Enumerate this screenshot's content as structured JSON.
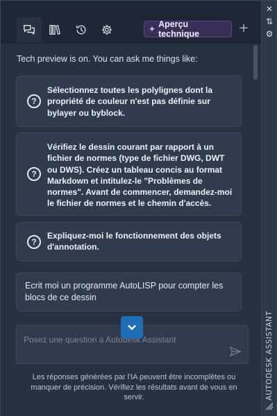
{
  "strip": {
    "close_glyph": "✕",
    "autohide_glyph": "⇅",
    "properties_glyph": "⚙",
    "title": "AUTODESK ASSISTANT"
  },
  "tabs": [
    {
      "name": "chat",
      "icon": "chat-icon",
      "active": true
    },
    {
      "name": "library",
      "icon": "library-icon",
      "active": false
    },
    {
      "name": "history",
      "icon": "history-icon",
      "active": false
    },
    {
      "name": "settings",
      "icon": "gear-icon",
      "active": false
    }
  ],
  "header": {
    "tech_preview_label": "Aperçu technique",
    "tech_preview_icon": "sparkle-icon",
    "new_chat_glyph": "+"
  },
  "intro": "Tech preview is on. You can ask me things like:",
  "suggestions": [
    {
      "text": "Sélectionnez toutes les polylignes dont la propriété de couleur n'est pas définie sur bylayer ou byblock."
    },
    {
      "text": "Vérifiez le dessin courant par rapport à un fichier de normes (type de fichier DWG, DWT ou DWS). Créez un tableau concis au format Markdown et intitulez-le \"Problèmes de normes\". Avant de commencer, demandez-moi le fichier de normes et le chemin d'accès."
    },
    {
      "text": "Expliquez-moi le fonctionnement des objets d'annotation."
    }
  ],
  "user_message": "Ecrit moi un programme AutoLISP pour compter les blocs de ce dessin",
  "input": {
    "placeholder": "Posez une question à Autodesk Assistant"
  },
  "disclaimer": "Les réponses générées par l'IA peuvent être incomplètes ou manquer de précision. Vérifiez les résultats avant de vous en servir.",
  "colors": {
    "panel_bg": "#273142",
    "card_bg": "#313b4d",
    "accent_blue": "#1f6fb6",
    "tech_preview_bg": "#3b2f57"
  }
}
